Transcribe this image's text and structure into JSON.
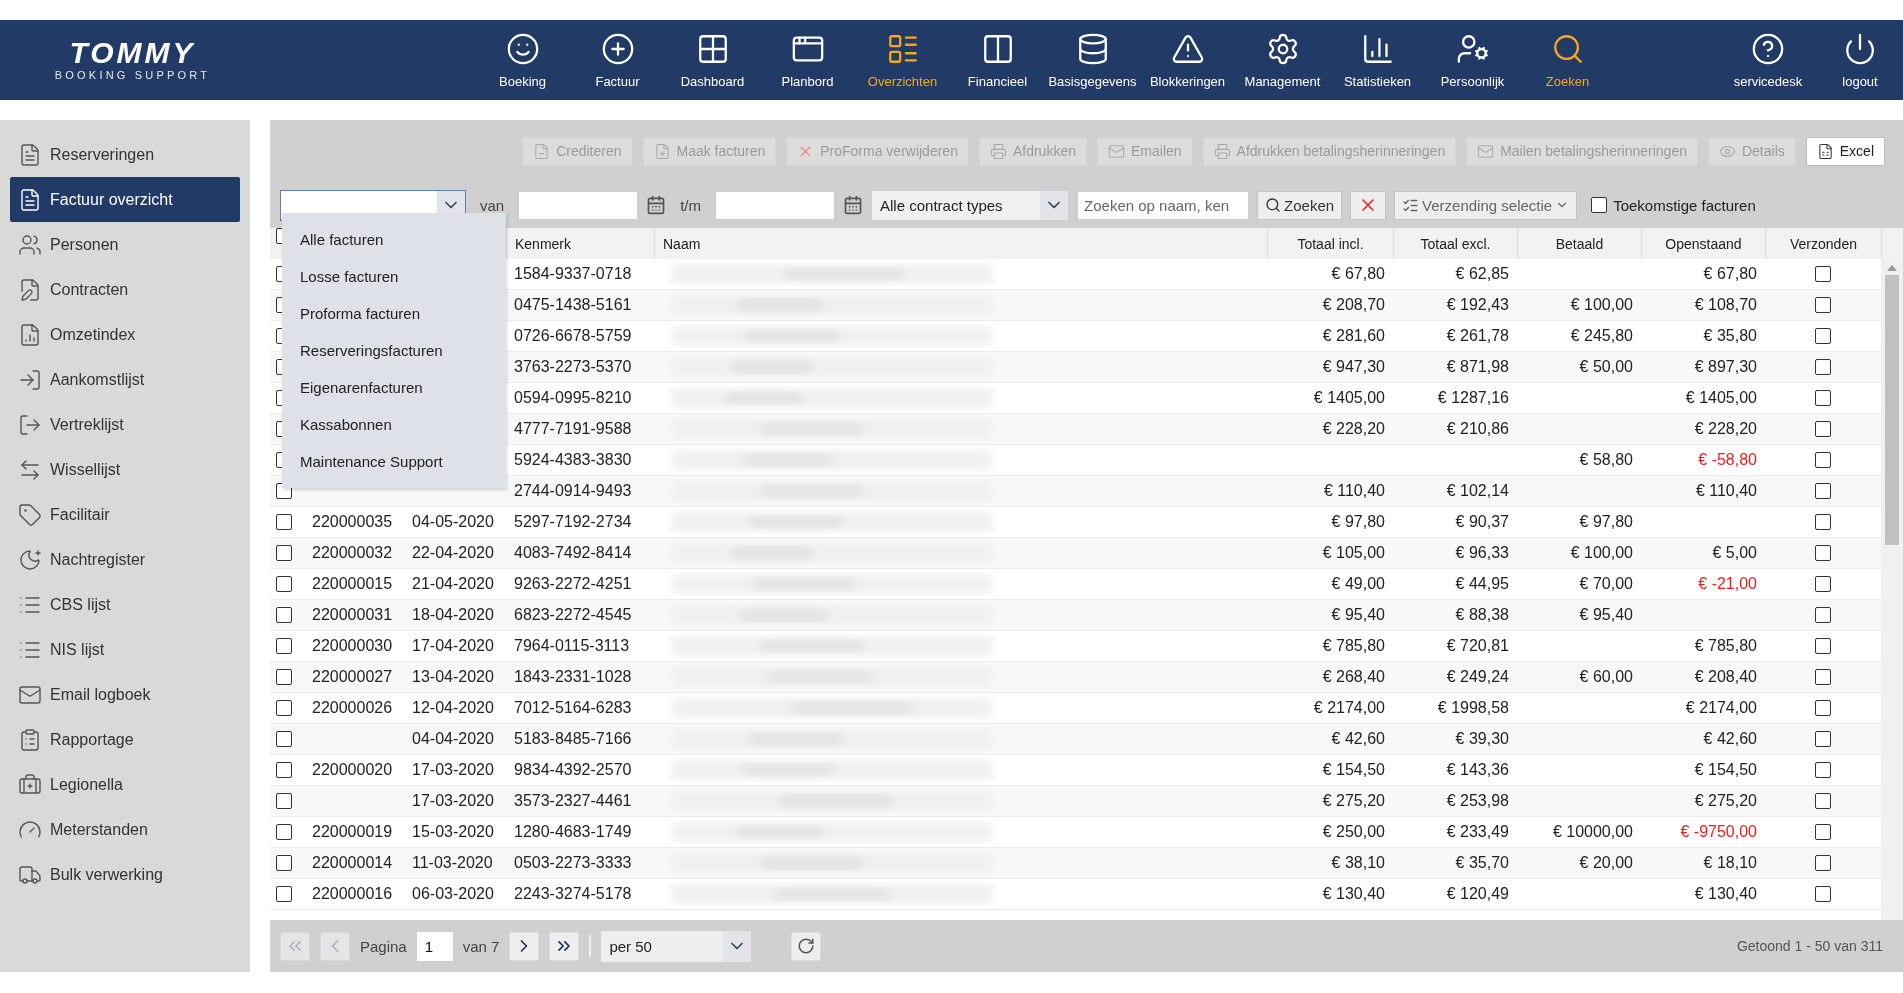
{
  "brand": {
    "name": "TOMMY",
    "tagline": "BOOKING SUPPORT"
  },
  "nav": [
    {
      "label": "Boeking",
      "selected": false
    },
    {
      "label": "Factuur",
      "selected": false
    },
    {
      "label": "Dashboard",
      "selected": false
    },
    {
      "label": "Planbord",
      "selected": false
    },
    {
      "label": "Overzichten",
      "selected": true
    },
    {
      "label": "Financieel",
      "selected": false
    },
    {
      "label": "Basisgegevens",
      "selected": false
    },
    {
      "label": "Blokkeringen",
      "selected": false
    },
    {
      "label": "Management",
      "selected": false
    },
    {
      "label": "Statistieken",
      "selected": false
    },
    {
      "label": "Persoonlijk",
      "selected": false
    },
    {
      "label": "Zoeken",
      "selected": true
    }
  ],
  "nav_right": [
    {
      "label": "servicedesk"
    },
    {
      "label": "logout"
    }
  ],
  "sidebar": [
    {
      "label": "Reserveringen",
      "selected": false
    },
    {
      "label": "Factuur overzicht",
      "selected": true
    },
    {
      "label": "Personen",
      "selected": false
    },
    {
      "label": "Contracten",
      "selected": false
    },
    {
      "label": "Omzetindex",
      "selected": false
    },
    {
      "label": "Aankomstlijst",
      "selected": false
    },
    {
      "label": "Vertreklijst",
      "selected": false
    },
    {
      "label": "Wissellijst",
      "selected": false
    },
    {
      "label": "Facilitair",
      "selected": false
    },
    {
      "label": "Nachtregister",
      "selected": false
    },
    {
      "label": "CBS lijst",
      "selected": false
    },
    {
      "label": "NIS lijst",
      "selected": false
    },
    {
      "label": "Email logboek",
      "selected": false
    },
    {
      "label": "Rapportage",
      "selected": false
    },
    {
      "label": "Legionella",
      "selected": false
    },
    {
      "label": "Meterstanden",
      "selected": false
    },
    {
      "label": "Bulk verwerking",
      "selected": false
    }
  ],
  "toolbar": [
    {
      "label": "Crediteren",
      "disabled": true
    },
    {
      "label": "Maak facturen",
      "disabled": true
    },
    {
      "label": "ProForma verwijderen",
      "disabled": true
    },
    {
      "label": "Afdrukken",
      "disabled": true
    },
    {
      "label": "Emailen",
      "disabled": true
    },
    {
      "label": "Afdrukken betalingsherinneringen",
      "disabled": true
    },
    {
      "label": "Mailen betalingsherinneringen",
      "disabled": true
    },
    {
      "label": "Details",
      "disabled": true
    },
    {
      "label": "Excel",
      "disabled": false
    }
  ],
  "filters": {
    "van_label": "van",
    "tm_label": "t/m",
    "contract_type": "Alle contract types",
    "search_placeholder": "Zoeken op naam, ken",
    "search_button": "Zoeken",
    "shipping_button": "Verzending selectie",
    "future_label": "Toekomstige facturen",
    "future_checked": false
  },
  "type_dropdown": {
    "expanded": true,
    "options": [
      {
        "label": "Alle facturen"
      },
      {
        "label": "Losse facturen"
      },
      {
        "label": "Proforma facturen"
      },
      {
        "label": "Reserveringsfacturen"
      },
      {
        "label": "Eigenarenfacturen"
      },
      {
        "label": "Kassabonnen"
      },
      {
        "label": "Maintenance Support"
      }
    ]
  },
  "table": {
    "select_all_checked": false,
    "columns": [
      {
        "label": "Kenmerk"
      },
      {
        "label": "Naam"
      },
      {
        "label": "Totaal incl."
      },
      {
        "label": "Totaal excl."
      },
      {
        "label": "Betaald"
      },
      {
        "label": "Openstaand"
      },
      {
        "label": "Verzonden"
      }
    ],
    "rows": [
      {
        "checked": false,
        "kenmerk": "1584-9337-0718",
        "incl": "€ 67,80",
        "excl": "€ 62,85",
        "open": "€ 67,80",
        "negative": false,
        "sent": false
      },
      {
        "checked": false,
        "kenmerk": "0475-1438-5161",
        "incl": "€ 208,70",
        "excl": "€ 192,43",
        "paid": "€ 100,00",
        "open": "€ 108,70",
        "negative": false,
        "sent": false
      },
      {
        "checked": false,
        "kenmerk": "0726-6678-5759",
        "incl": "€ 281,60",
        "excl": "€ 261,78",
        "paid": "€ 245,80",
        "open": "€ 35,80",
        "negative": false,
        "sent": false
      },
      {
        "checked": false,
        "kenmerk": "3763-2273-5370",
        "incl": "€ 947,30",
        "excl": "€ 871,98",
        "paid": "€ 50,00",
        "open": "€ 897,30",
        "negative": false,
        "sent": false
      },
      {
        "checked": false,
        "kenmerk": "0594-0995-8210",
        "incl": "€ 1405,00",
        "excl": "€ 1287,16",
        "open": "€ 1405,00",
        "negative": false,
        "sent": false
      },
      {
        "checked": false,
        "kenmerk": "4777-7191-9588",
        "incl": "€ 228,20",
        "excl": "€ 210,86",
        "open": "€ 228,20",
        "negative": false,
        "sent": false
      },
      {
        "checked": false,
        "kenmerk": "5924-4383-3830",
        "paid": "€ 58,80",
        "open": "€ -58,80",
        "negative": true,
        "sent": false
      },
      {
        "checked": false,
        "kenmerk": "2744-0914-9493",
        "incl": "€ 110,40",
        "excl": "€ 102,14",
        "open": "€ 110,40",
        "negative": false,
        "sent": false
      },
      {
        "checked": false,
        "nr": "220000035",
        "date": "04-05-2020",
        "kenmerk": "5297-7192-2734",
        "incl": "€ 97,80",
        "excl": "€ 90,37",
        "paid": "€ 97,80",
        "sent": false
      },
      {
        "checked": false,
        "nr": "220000032",
        "date": "22-04-2020",
        "kenmerk": "4083-7492-8414",
        "incl": "€ 105,00",
        "excl": "€ 96,33",
        "paid": "€ 100,00",
        "open": "€ 5,00",
        "negative": false,
        "sent": false
      },
      {
        "checked": false,
        "nr": "220000015",
        "date": "21-04-2020",
        "kenmerk": "9263-2272-4251",
        "incl": "€ 49,00",
        "excl": "€ 44,95",
        "paid": "€ 70,00",
        "open": "€ -21,00",
        "negative": true,
        "sent": false
      },
      {
        "checked": false,
        "nr": "220000031",
        "date": "18-04-2020",
        "kenmerk": "6823-2272-4545",
        "incl": "€ 95,40",
        "excl": "€ 88,38",
        "paid": "€ 95,40",
        "sent": false
      },
      {
        "checked": false,
        "nr": "220000030",
        "date": "17-04-2020",
        "kenmerk": "7964-0115-3113",
        "incl": "€ 785,80",
        "excl": "€ 720,81",
        "open": "€ 785,80",
        "negative": false,
        "sent": false
      },
      {
        "checked": false,
        "nr": "220000027",
        "date": "13-04-2020",
        "kenmerk": "1843-2331-1028",
        "incl": "€ 268,40",
        "excl": "€ 249,24",
        "paid": "€ 60,00",
        "open": "€ 208,40",
        "negative": false,
        "sent": false
      },
      {
        "checked": false,
        "nr": "220000026",
        "date": "12-04-2020",
        "kenmerk": "7012-5164-6283",
        "incl": "€ 2174,00",
        "excl": "€ 1998,58",
        "open": "€ 2174,00",
        "negative": false,
        "sent": false
      },
      {
        "checked": false,
        "date": "04-04-2020",
        "kenmerk": "5183-8485-7166",
        "incl": "€ 42,60",
        "excl": "€ 39,30",
        "open": "€ 42,60",
        "negative": false,
        "sent": false
      },
      {
        "checked": false,
        "nr": "220000020",
        "date": "17-03-2020",
        "kenmerk": "9834-4392-2570",
        "incl": "€ 154,50",
        "excl": "€ 143,36",
        "open": "€ 154,50",
        "negative": false,
        "sent": false
      },
      {
        "checked": false,
        "date": "17-03-2020",
        "kenmerk": "3573-2327-4461",
        "incl": "€ 275,20",
        "excl": "€ 253,98",
        "open": "€ 275,20",
        "negative": false,
        "sent": false
      },
      {
        "checked": false,
        "nr": "220000019",
        "date": "15-03-2020",
        "kenmerk": "1280-4683-1749",
        "incl": "€ 250,00",
        "excl": "€ 233,49",
        "paid": "€ 10000,00",
        "open": "€ -9750,00",
        "negative": true,
        "sent": false
      },
      {
        "checked": false,
        "nr": "220000014",
        "date": "11-03-2020",
        "kenmerk": "0503-2273-3333",
        "incl": "€ 38,10",
        "excl": "€ 35,70",
        "paid": "€ 20,00",
        "open": "€ 18,10",
        "negative": false,
        "sent": false
      },
      {
        "checked": false,
        "nr": "220000016",
        "date": "06-03-2020",
        "kenmerk": "2243-3274-5178",
        "incl": "€ 130,40",
        "excl": "€ 120,49",
        "open": "€ 130,40",
        "negative": false,
        "sent": false
      }
    ]
  },
  "pager": {
    "page_label": "Pagina",
    "page": "1",
    "of_label": "van 7",
    "per_page": "per 50",
    "first_disabled": true,
    "prev_disabled": true,
    "summary": "Getoond 1 - 50 van 311"
  }
}
